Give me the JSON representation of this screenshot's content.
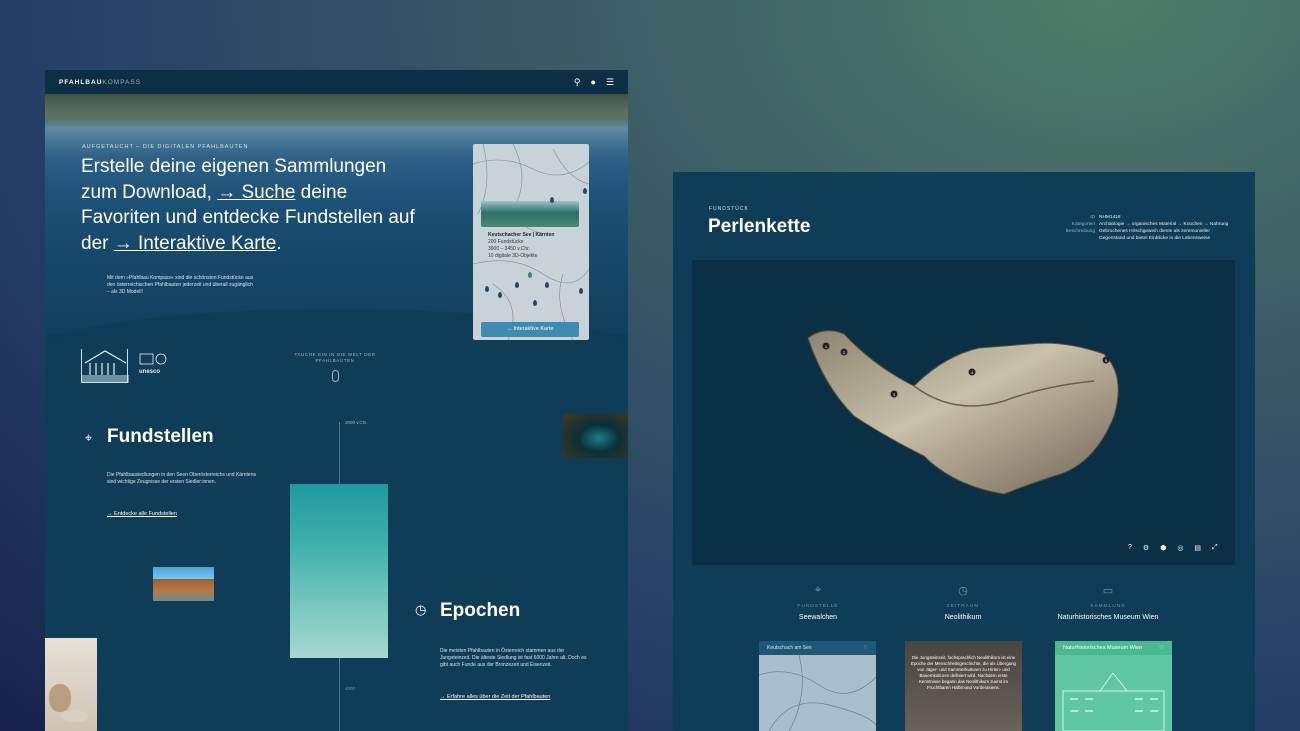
{
  "left_page": {
    "brand": {
      "strong": "PFAHLBAU",
      "light": "KOMPASS"
    },
    "icons": {
      "search": "search-icon",
      "user": "user-icon",
      "menu": "menu-icon"
    },
    "hero": {
      "eyebrow": "AUFGETAUCHT – DIE DIGITALEN PFAHLBAUTEN",
      "headline_1": "Erstelle deine eigenen Sammlungen zum Download, ",
      "link_search": "→ Suche",
      "headline_2": " deine Favoriten und entdecke Fundstellen auf der ",
      "link_map": "→ Interaktive Karte",
      "headline_3": ".",
      "intro": "Mit dem »Pfahlbau Kompass« sind die schönsten Fundstücke aus den österreichischen Pfahlbauten jederzeit und überall zugänglich – als 3D Modell!"
    },
    "map_card": {
      "title": "Keutschacher See | Kärnten",
      "line1": "200 Fundstücke",
      "line2": "3900 – 3450 v.Chr.",
      "line3": "10 digitale 3D-Objekte",
      "button": "→ Interaktive Karte"
    },
    "logos": {
      "unesco": "unesco"
    },
    "scroll_hint": "TAUCHE EIN IN DIE WELT DER PFAHLBAUTEN",
    "timeline": {
      "top": "2000 v.Chr.",
      "bottom": "4000"
    },
    "fundstellen": {
      "title": "Fundstellen",
      "text": "Die Pfahlbausiedlungen in den Seen Oberösterreichs und Kärntens sind wichtige Zeugnisse der ersten Siedler:innen.",
      "link": "→ Entdecke alle Fundstellen"
    },
    "epochen": {
      "title": "Epochen",
      "text": "Die meisten Pfahlbauten in Österreich stammen aus der Jungsteinzeit. Die älteste Siedlung ist fast 6000 Jahre alt. Doch es gibt auch Funde aus der Bronzezeit und Eisenzeit.",
      "link": "→ Erfahre alles über die Zeit der Pfahlbauten"
    }
  },
  "right_page": {
    "eyebrow": "FUNDSTÜCK",
    "title": "Perlenkette",
    "meta": [
      {
        "label": "ID",
        "value": "NHM1418"
      },
      {
        "label": "Kategorien",
        "value": "Archäologie → organisches Material → Knochen → Nahrung"
      },
      {
        "label": "Beschreibung",
        "value": "Gebrochenes Hirschgeweih diente als zeremonieller Gegenstand und bietet Einblicke in die Lebensweise"
      }
    ],
    "viewer_markers": [
      "1",
      "2",
      "3",
      "4",
      "5"
    ],
    "viewer_tools": [
      "?",
      "⚙",
      "⬢",
      "◎",
      "▤",
      "⤢"
    ],
    "columns": [
      {
        "icon": "location-pin-icon",
        "label": "FUNDSTELLE",
        "value": "Seewalchen"
      },
      {
        "icon": "clock-icon",
        "label": "ZEITRAUM",
        "value": "Neolithikum"
      },
      {
        "icon": "folder-icon",
        "label": "SAMMLUNG",
        "value": "Naturhistorisches Museum Wien"
      }
    ],
    "cards": {
      "map": "Keutschach am See",
      "epoch_text": "Die Jungsteinzeit, fachsprachlich Neolithikum ist eine Epoche der Menschheitsgeschichte, die als Übergang von Jäger- und Sammlerkulturen zu Hirten- und Bauernkulturen definiert wird. Nachdem erste Kenntnisse begann das Neolithikum zuerst im Fruchtbaren Halbmond Vorderasiens.",
      "museum": "Naturhistorisches Museum Wien"
    }
  }
}
